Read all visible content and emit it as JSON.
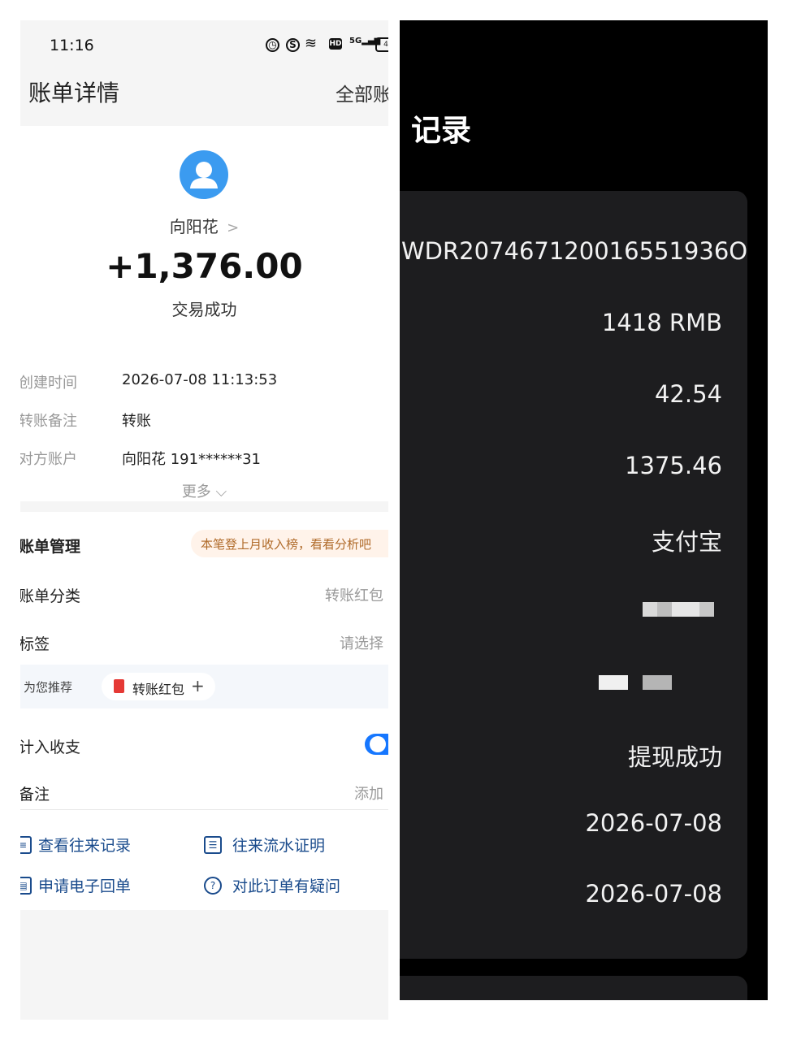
{
  "left": {
    "status_bar": {
      "time": "11:16",
      "net_label": "5G",
      "hd_label": "HD",
      "battery_label": "4"
    },
    "header": {
      "title": "账单详情",
      "all_bills": "全部账"
    },
    "summary": {
      "payer_name": "向阳花",
      "chevron": ">",
      "amount": "+1,376.00",
      "status": "交易成功"
    },
    "details": [
      {
        "label": "创建时间",
        "value": "2026-07-08 11:13:53"
      },
      {
        "label": "转账备注",
        "value": "转账"
      },
      {
        "label": "对方账户",
        "value": "向阳花 191******31"
      }
    ],
    "more": "更多 ⌵",
    "management": {
      "title": "账单管理",
      "analysis_hint": "本笔登上月收入榜，看看分析吧",
      "category": {
        "label": "账单分类",
        "value": "转账红包"
      },
      "tags": {
        "label": "标签",
        "value": "请选择"
      },
      "recommend": {
        "label": "为您推荐",
        "chip": "转账红包",
        "plus": "+"
      },
      "count_income": {
        "label": "计入收支",
        "enabled": true
      },
      "remark": {
        "label": "备注",
        "value": "添加"
      }
    },
    "actions": [
      {
        "label": "查看往来记录",
        "icon": "record-icon"
      },
      {
        "label": "往来流水证明",
        "icon": "statement-icon"
      },
      {
        "label": "申请电子回单",
        "icon": "receipt-icon"
      },
      {
        "label": "对此订单有疑问",
        "icon": "question-icon"
      }
    ]
  },
  "right": {
    "title": "记录",
    "order_id": "WDR207467120016551936O",
    "values": [
      "1418 RMB",
      "42.54",
      "1375.46",
      "支付宝",
      "提现成功",
      "2026-07-08",
      "2026-07-08"
    ]
  },
  "colors": {
    "accent_blue": "#1677ff",
    "avatar_blue": "#3b9bf0",
    "link_blue": "#1a4b8c",
    "dark_card": "#1d1d1f"
  }
}
